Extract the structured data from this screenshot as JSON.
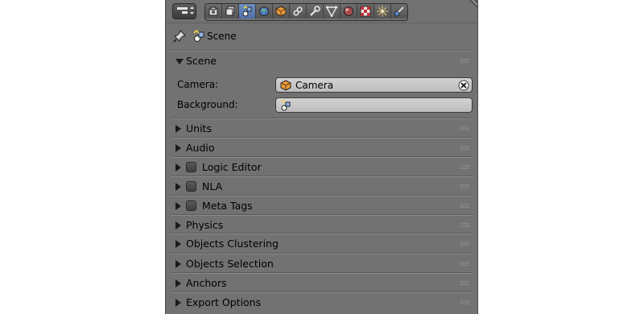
{
  "header": {
    "context_tabs": [
      {
        "name": "render-icon",
        "active": false
      },
      {
        "name": "render-layers-icon",
        "active": false
      },
      {
        "name": "scene-icon",
        "active": true
      },
      {
        "name": "world-icon",
        "active": false
      },
      {
        "name": "object-icon",
        "active": false
      },
      {
        "name": "constraints-icon",
        "active": false
      },
      {
        "name": "modifiers-icon",
        "active": false
      },
      {
        "name": "data-icon",
        "active": false
      },
      {
        "name": "material-icon",
        "active": false
      },
      {
        "name": "texture-icon",
        "active": false
      },
      {
        "name": "particles-icon",
        "active": false
      },
      {
        "name": "physics-icon",
        "active": false
      }
    ],
    "accent_color": "#5a7db5"
  },
  "path": {
    "label": "Scene"
  },
  "scene_panel": {
    "title": "Scene",
    "camera_label": "Camera:",
    "camera_value": "Camera",
    "background_label": "Background:",
    "background_value": ""
  },
  "panels": [
    {
      "title": "Units",
      "checkbox": false
    },
    {
      "title": "Audio",
      "checkbox": false
    },
    {
      "title": "Logic Editor",
      "checkbox": true
    },
    {
      "title": "NLA",
      "checkbox": true
    },
    {
      "title": "Meta Tags",
      "checkbox": true
    },
    {
      "title": "Physics",
      "checkbox": false
    },
    {
      "title": "Objects Clustering",
      "checkbox": false
    },
    {
      "title": "Objects Selection",
      "checkbox": false
    },
    {
      "title": "Anchors",
      "checkbox": false
    },
    {
      "title": "Export Options",
      "checkbox": false
    }
  ]
}
